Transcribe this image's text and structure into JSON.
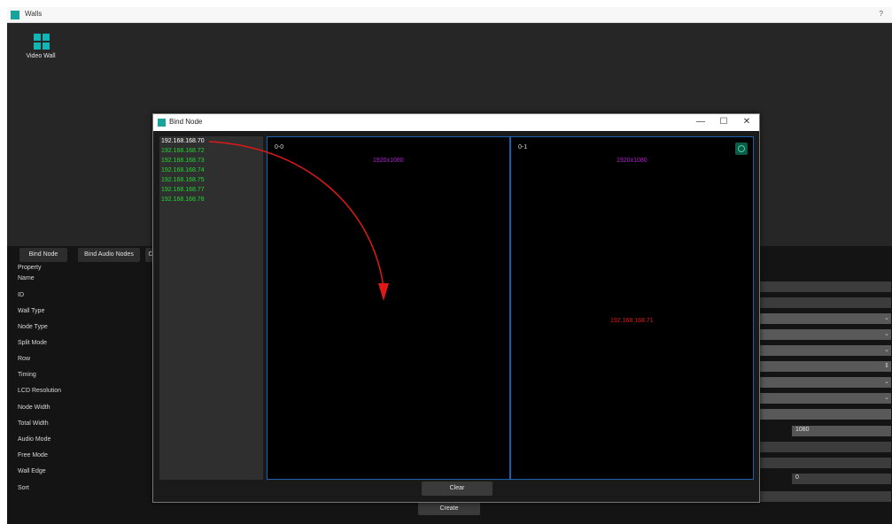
{
  "main_window": {
    "title": "Walls",
    "help": "?"
  },
  "wall_item": {
    "label": "Video Wall"
  },
  "tabs": [
    "Bind Node",
    "Bind Audio Nodes",
    "C"
  ],
  "properties": {
    "heading": "Property",
    "labels": [
      "Name",
      "ID",
      "Wall Type",
      "Node Type",
      "Split Mode",
      "Row",
      "Timing",
      "LCD Resolution",
      "Node Width",
      "Total Width",
      "Audio Mode",
      "Free Mode",
      "Wall Edge",
      "Sort"
    ],
    "total_width_value": "1080",
    "wall_edge_value": "0"
  },
  "create_button": "Create",
  "dialog": {
    "title": "Bind Node",
    "minimize": "—",
    "maximize": "☐",
    "close": "✕",
    "nodes": [
      "192.168.168.70",
      "192.168.168.72",
      "192.168.168.73",
      "192.168.168.74",
      "192.168.168.75",
      "192.168.168.77",
      "192.168.168.78"
    ],
    "selected_node": "192.168.168.70",
    "screens": [
      {
        "id": "0-0",
        "resolution": "1920x1080",
        "bound_node": ""
      },
      {
        "id": "0-1",
        "resolution": "1920x1080",
        "bound_node": "192.168.168.71"
      }
    ],
    "clear_button": "Clear"
  },
  "colors": {
    "node_available": "#22d633",
    "resolution_text": "#b01fd1",
    "bound_node_text": "#e01818",
    "screen_border": "#1d5fb0",
    "drag_arrow": "#e01818"
  },
  "icons": [
    "app-icon",
    "video-wall-icon",
    "unbind-icon",
    "dropdown-chevron-icon"
  ]
}
